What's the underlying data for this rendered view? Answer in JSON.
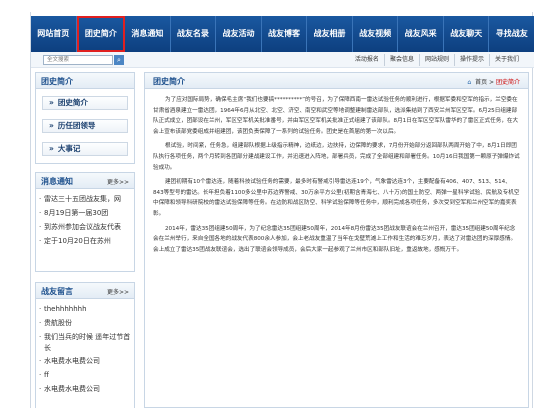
{
  "nav": {
    "items": [
      "网站首页",
      "团史简介",
      "消息通知",
      "战友名录",
      "战友活动",
      "战友博客",
      "战友相册",
      "战友视频",
      "战友风采",
      "战友聊天",
      "寻找战友"
    ],
    "active_index": 1
  },
  "subbar": {
    "search_placeholder": "全文搜索",
    "search_icon": "search-icon",
    "links": [
      "活动报名",
      "聚会信息",
      "网站规则",
      "操作提示",
      "关于我们"
    ]
  },
  "sidebar": {
    "intro": {
      "title": "团史简介",
      "items": [
        "团史简介",
        "历任团领导",
        "大事记"
      ]
    },
    "notices": {
      "title": "消息通知",
      "more": "更多>>",
      "items": [
        "雷达三十五团战友集，网",
        "8月19日第一届30团",
        "到苏州参加会议战友代表",
        "定于10月20日在苏州"
      ]
    },
    "friends": {
      "title": "战友留言",
      "more": "更多>>",
      "items": [
        "thehhhhhhh",
        "贵航股份",
        "我们当兵的时候 遥年过节首长",
        "水电费水电费公司",
        "ff",
        "水电费水电费公司"
      ]
    }
  },
  "main": {
    "title": "团史简介",
    "breadcrumb": {
      "home": "首页",
      "sep": ">",
      "current": "团史简介"
    },
    "paragraphs": [
      "为了应对国际局势，确保毛主席“我们也要搞**********”的号召，为了保障西南一雷达试验任务的顺利进行，根据军委和空军的指示，兰空委在甘肃省酒泉建立一雷达团，1964年6月从北空、北空、济空、南空和武空等地调整建制雷达部队，选派集结到了西安兰州军区空军。6月25日组建部队正式成立，团部设在兰州，军区空军机关批准番号，并由军区空军机关批准正式组建了该部队。8月1日在军区空军队雷华的了雷区正式任务，在大会上宣布该部党委组成并组建团，该团负责保障了一系列的试验任务。团史是在首届的第一次以后。",
      "根试验，时间紧，任务急，组建部队根据上级指示精神，边纸边，边扶持，边保障的要求，7月份开始部分返回部队两周开始了中，8月1日即团队执行各项任务，两个月转到各团部分建战建设工作，并迅速进入阵地，部署兵员，完成了全部组建和部署任务。10月16日我国第一颗原子弹爆炸试验成功。",
      "建团初期有10个雷达连，随着科技试验任务的需要，最多时有警戒引导雷达连19个，气象雷达连3个，主要配备有406、407、513、514、843等型号的雷达。长年担负着1100多公里中苏边界警戒、30万余平方公里(初期含青海七、八十万)的国土防空、两弹一星科学试验、民航及专机空中保障和领导科研院校的雷达试验保障等任务。在边防和战区防空、科学试验保障等任务中，顺利完成各项任务，多次受到空军和兰州空军的嘉奖表彰。",
      "2014年，雷达35团组建50周年，为了纪念雷达35团组建50周年，2014年8月份雷达35团战友联谊会在兰州召开，雷达35团组建50周年纪念会在兰州举行，来自全国各地的战友代表800余人参加，会上老战友重温了当年在戈壁荒滩上工作和生活的难忘岁月，表达了对雷达团的深厚感情。会上成立了雷达35团战友联谊会，选出了联谊会领导成员，会后大家一起参观了兰州市区和部队旧址，重返故地，感慨万千。"
    ]
  }
}
